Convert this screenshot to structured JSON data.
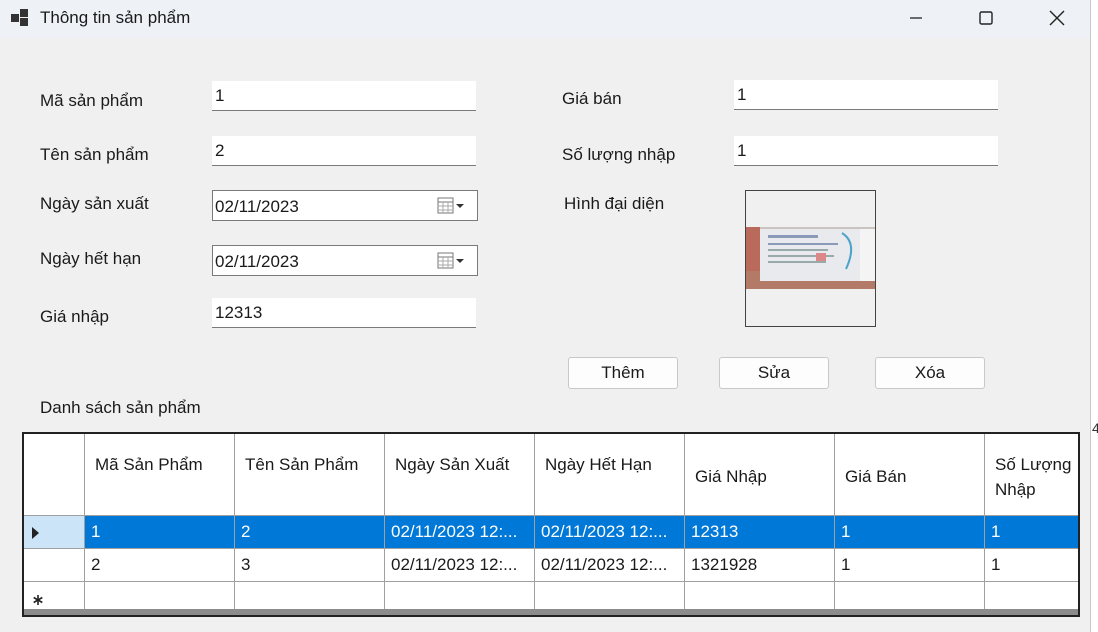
{
  "window": {
    "title": "Thông tin sản phẩm",
    "icon": "app-icon",
    "controls": [
      "minimize-icon",
      "maximize-icon",
      "close-icon"
    ]
  },
  "form": {
    "ma_san_pham": {
      "label": "Mã sản phẩm",
      "value": "1"
    },
    "ten_san_pham": {
      "label": "Tên sản phẩm",
      "value": "2"
    },
    "ngay_san_xuat": {
      "label": "Ngày sản xuất",
      "value": "02/11/2023"
    },
    "ngay_het_han": {
      "label": "Ngày hết hạn",
      "value": "02/11/2023"
    },
    "gia_nhap": {
      "label": "Giá nhập",
      "value": "12313"
    },
    "gia_ban": {
      "label": "Giá bán",
      "value": "1"
    },
    "so_luong_nhap": {
      "label": "Số lượng nhập",
      "value": "1"
    },
    "hinh_dai_dien": {
      "label": "Hình đại diện"
    }
  },
  "buttons": {
    "them": "Thêm",
    "sua": "Sửa",
    "xoa": "Xóa"
  },
  "list_label": "Danh sách sản phẩm",
  "table": {
    "columns": [
      "Mã Sản Phẩm",
      "Tên Sản Phẩm",
      "Ngày Sản Xuất",
      "Ngày Hết Hạn",
      "Giá Nhập",
      "Giá Bán",
      "Số Lượng Nhập"
    ],
    "rows": [
      [
        "1",
        "2",
        "02/11/2023 12:...",
        "02/11/2023 12:...",
        "12313",
        "1",
        "1"
      ],
      [
        "2",
        "3",
        "02/11/2023 12:...",
        "02/11/2023 12:...",
        "1321928",
        "1",
        "1"
      ]
    ],
    "selected_row": 0
  },
  "clipped_edge_text": "4",
  "colors": {
    "selection": "#0078d7",
    "titlebar": "#eef2f6",
    "form_bg": "#f0f0f0"
  }
}
